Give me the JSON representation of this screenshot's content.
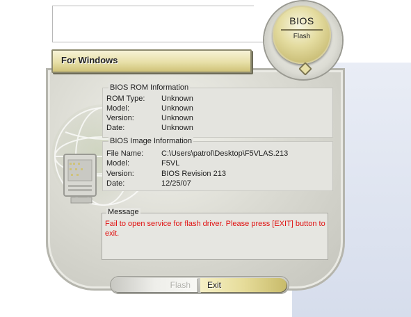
{
  "window": {
    "title": "For Windows"
  },
  "logo": {
    "title": "BIOS",
    "subtitle": "Flash"
  },
  "rom_info": {
    "legend": "BIOS ROM Information",
    "rows": [
      {
        "label": "ROM Type:",
        "value": "Unknown"
      },
      {
        "label": "Model:",
        "value": "Unknown"
      },
      {
        "label": "Version:",
        "value": "Unknown"
      },
      {
        "label": "Date:",
        "value": "Unknown"
      }
    ]
  },
  "image_info": {
    "legend": "BIOS Image Information",
    "rows": [
      {
        "label": "File Name:",
        "value": "C:\\Users\\patrol\\Desktop\\F5VLAS.213"
      },
      {
        "label": "Model:",
        "value": "F5VL"
      },
      {
        "label": "Version:",
        "value": "BIOS Revision 213"
      },
      {
        "label": "Date:",
        "value": "12/25/07"
      }
    ]
  },
  "message": {
    "legend": "Message",
    "text": "Fail to open service for flash driver. Please press [EXIT] button to exit.",
    "color": "#e01010"
  },
  "buttons": {
    "flash_label": "Flash",
    "exit_label": "Exit"
  },
  "colors": {
    "accent_gold": "#e6dc9a",
    "disabled_text": "#b0b0aa"
  }
}
